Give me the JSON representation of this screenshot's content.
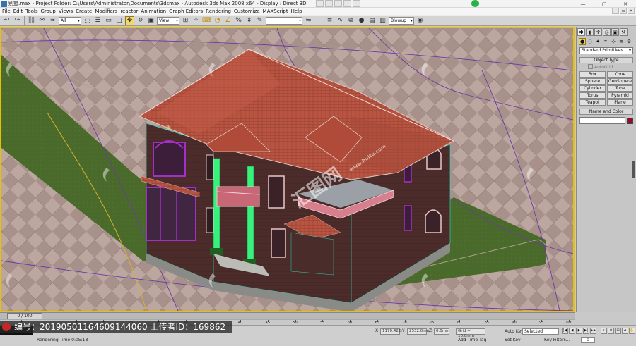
{
  "window": {
    "file_name": "别墅.max",
    "title_text": "别墅.max    - Project Folder: C:\\Users\\Administrator\\Documents\\3dsmax      - Autodesk 3ds Max 2008 x64      - Display : Direct 3D",
    "controls": [
      "—",
      "▢",
      "✕"
    ]
  },
  "menu": {
    "items": [
      "File",
      "Edit",
      "Tools",
      "Group",
      "Views",
      "Create",
      "Modifiers",
      "reactor",
      "Animation",
      "Graph Editors",
      "Rendering",
      "Customize",
      "MAXScript",
      "Help"
    ]
  },
  "toolbar": {
    "selection_filter": "All",
    "reference_coord": "View",
    "named_selection": "",
    "render_preset": "Blowup"
  },
  "viewport": {
    "label": "",
    "watermark_text": "汇图网",
    "watermark_url": "www.huitu.com"
  },
  "command_panel": {
    "tabs": [
      "create-icon",
      "modify-icon",
      "hierarchy-icon",
      "motion-icon",
      "display-icon",
      "utilities-icon"
    ],
    "category_dropdown": "Standard Primitives",
    "object_type_header": "Object Type",
    "autogrid_label": "AutoGrid",
    "object_buttons": [
      "Box",
      "Cone",
      "Sphere",
      "GeoSphere",
      "Cylinder",
      "Tube",
      "Torus",
      "Pyramid",
      "Teapot",
      "Plane"
    ],
    "name_color_header": "Name and Color",
    "object_color": "#99092c"
  },
  "timeline": {
    "slider_text": "0 / 100",
    "ticks": [
      "0",
      "10",
      "15",
      "20",
      "25",
      "30",
      "35",
      "40",
      "45",
      "50",
      "55",
      "60",
      "65",
      "70",
      "75",
      "80",
      "85",
      "90",
      "95",
      "100"
    ]
  },
  "status": {
    "x_value": "1170.422r",
    "y_value": "2532.0mm",
    "z_value": "0.0mm",
    "grid_text": "Grid = 10.0mm",
    "render_time": "Rendering Time  0:05:18",
    "add_time_tag": "Add Time Tag",
    "auto_key": "Auto Key",
    "selected_label": "Selected",
    "set_key": "Set Key",
    "key_filters": "Key Filters...",
    "frame_number": "0"
  },
  "watermark_bar": {
    "text": "编号：20190501164609144060 上传者ID：169862"
  },
  "colors": {
    "viewport_floor": "#a8918b",
    "lawn": "#4a6a2c",
    "roof": "#b75542",
    "wall": "#4c2c2a",
    "selection_outline": "#e8c200",
    "window_frames": "#a32fc9",
    "columns": "#38f07c"
  }
}
